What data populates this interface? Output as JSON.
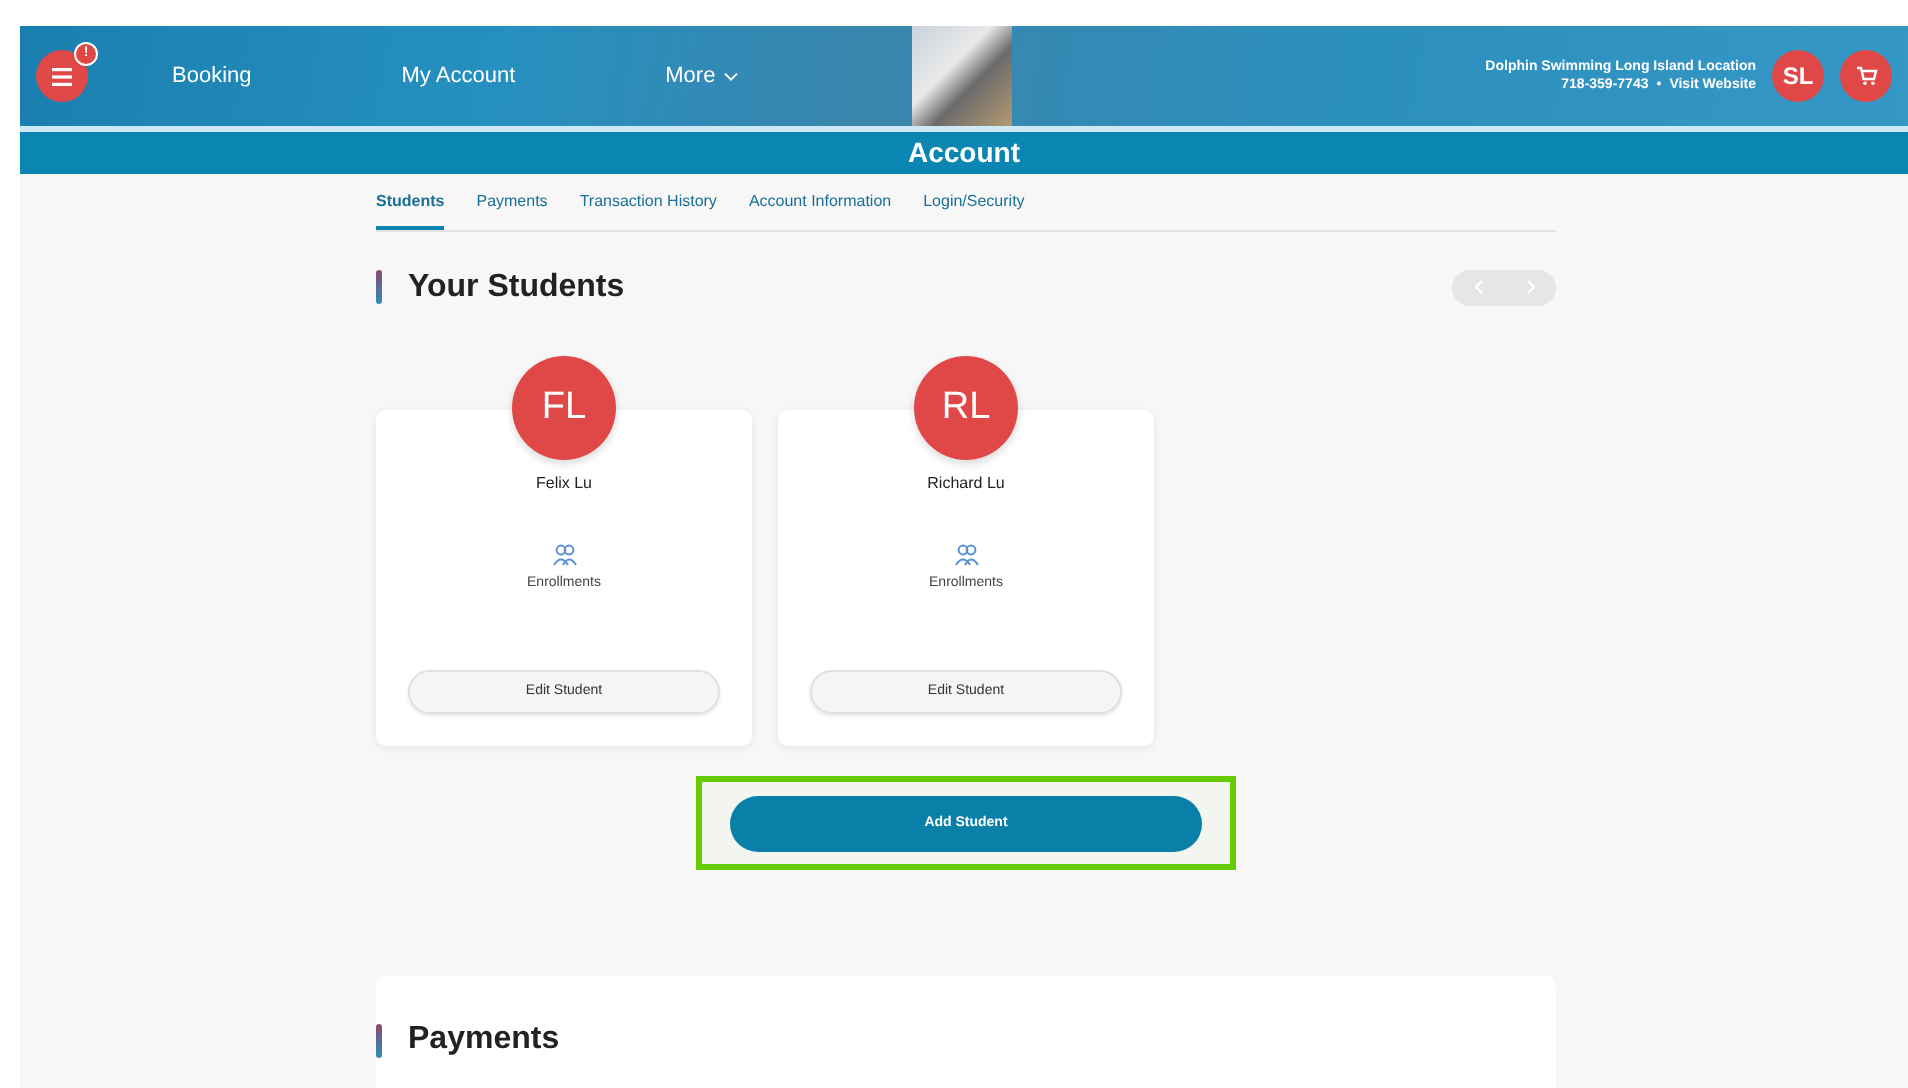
{
  "header": {
    "menu_badge": "!",
    "nav": [
      {
        "label": "Booking",
        "dropdown": false
      },
      {
        "label": "My Account",
        "dropdown": false
      },
      {
        "label": "More",
        "dropdown": true
      }
    ],
    "location": "Dolphin Swimming Long Island Location",
    "phone": "718-359-7743",
    "separator": "•",
    "website_link": "Visit Website",
    "user_initials": "SL"
  },
  "page_title": "Account",
  "tabs": [
    {
      "label": "Students",
      "selected": true
    },
    {
      "label": "Payments",
      "selected": false
    },
    {
      "label": "Transaction History",
      "selected": false
    },
    {
      "label": "Account Information",
      "selected": false
    },
    {
      "label": "Login/Security",
      "selected": false
    }
  ],
  "students_section": {
    "title": "Your Students",
    "students": [
      {
        "initials": "FL",
        "name": "Felix Lu",
        "enrollments_label": "Enrollments",
        "edit_button": "Edit Student"
      },
      {
        "initials": "RL",
        "name": "Richard Lu",
        "enrollments_label": "Enrollments",
        "edit_button": "Edit Student"
      }
    ],
    "add_button": "Add Student",
    "add_button_highlighted": true
  },
  "next_section": {
    "title": "Payments"
  }
}
